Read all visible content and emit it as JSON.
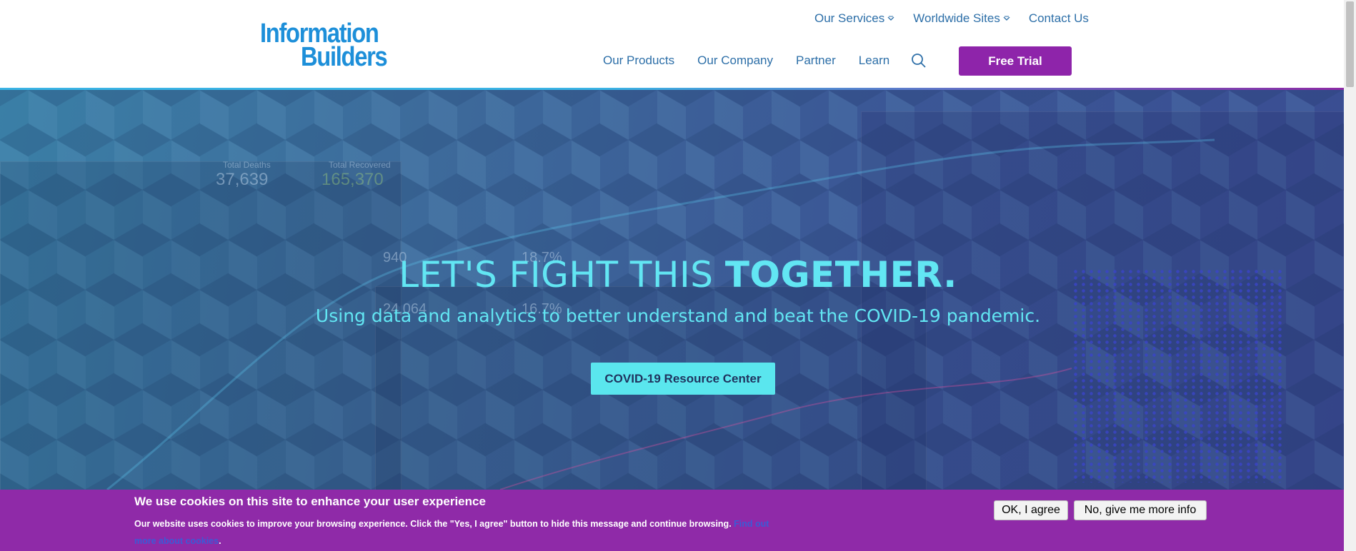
{
  "brand": {
    "logo_line1": "Information",
    "logo_line2": "Builders"
  },
  "top_nav": [
    {
      "label": "Our Services",
      "dropdown": true
    },
    {
      "label": "Worldwide Sites",
      "dropdown": true
    },
    {
      "label": "Contact Us",
      "dropdown": false
    }
  ],
  "main_nav": {
    "items": [
      "Our Products",
      "Our Company",
      "Partner",
      "Learn"
    ],
    "search_icon": "search-icon",
    "trial_label": "Free Trial"
  },
  "hero": {
    "headline_light": "LET'S FIGHT THIS ",
    "headline_bold": "TOGETHER.",
    "subline": "Using data and analytics to better understand and beat the COVID-19 pandemic.",
    "cta_label": "COVID-19 Resource Center",
    "background_stats": {
      "deaths_label": "Total Deaths",
      "deaths_value": "37,639",
      "recovered_label": "Total Recovered",
      "recovered_value": "165,370",
      "s1": "940",
      "s2": "18.7%",
      "s3": "24,064",
      "s4": "16.7%"
    }
  },
  "cookie": {
    "title": "We use cookies on this site to enhance your user experience",
    "text": "Our website uses cookies to improve your browsing experience. Click the \"Yes, I agree\" button to hide this message and continue browsing. ",
    "link_text": "Find out more about cookies",
    "text_end": ".",
    "ok_label": "OK, I agree",
    "info_label": "No, give me more info"
  },
  "colors": {
    "brand_blue": "#1d8fd9",
    "nav_text": "#2d6fa8",
    "trial_purple": "#8e24aa",
    "hero_cyan": "#62e6f3",
    "cookie_purple": "#8f2aa8"
  }
}
